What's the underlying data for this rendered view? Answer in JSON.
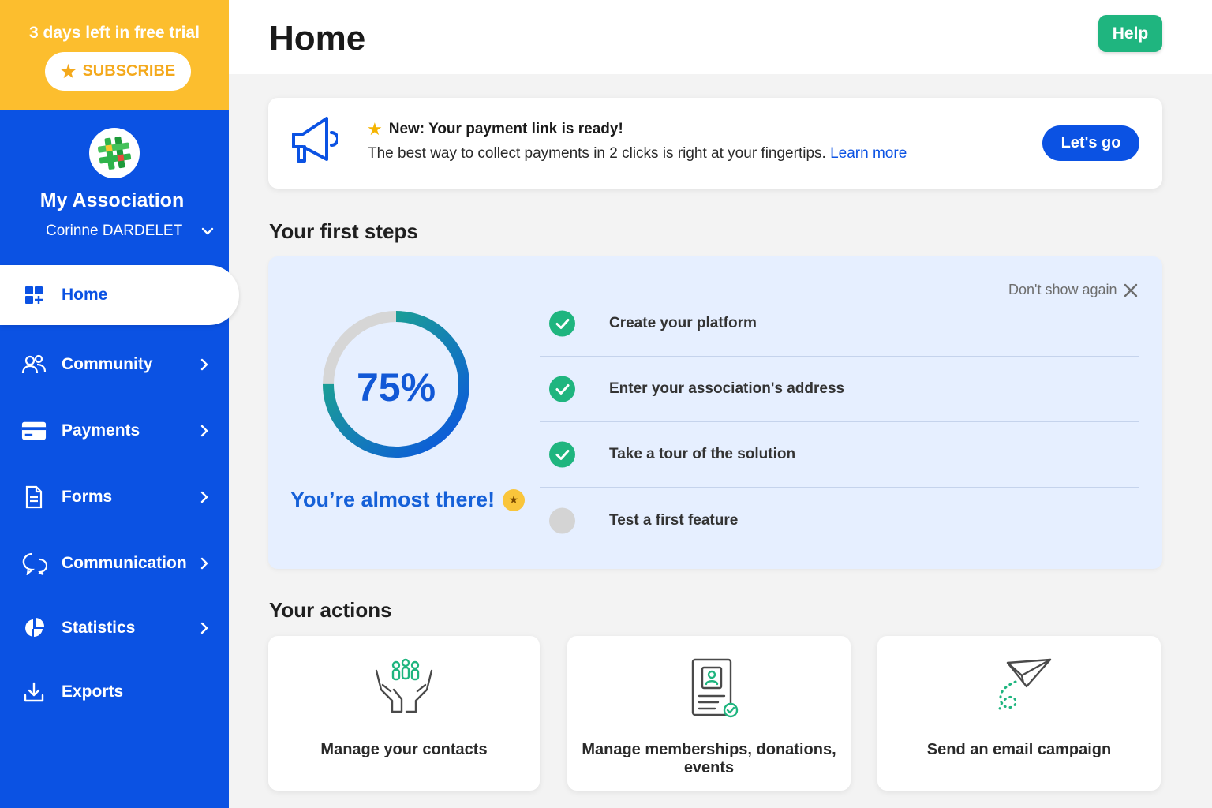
{
  "trial": {
    "text": "3 days left in free trial",
    "subscribe_label": "SUBSCRIBE"
  },
  "organization": {
    "name": "My Association",
    "user": "Corinne DARDELET"
  },
  "nav": {
    "items": [
      {
        "label": "Home",
        "icon": "home-grid-icon",
        "active": true
      },
      {
        "label": "Community",
        "icon": "users-icon"
      },
      {
        "label": "Payments",
        "icon": "card-icon"
      },
      {
        "label": "Forms",
        "icon": "document-icon"
      },
      {
        "label": "Communication",
        "icon": "chat-icon"
      },
      {
        "label": "Statistics",
        "icon": "pie-chart-icon"
      },
      {
        "label": "Exports",
        "icon": "download-icon"
      }
    ]
  },
  "header": {
    "title": "Home",
    "help_label": "Help"
  },
  "banner": {
    "title": "New: Your payment link is ready!",
    "text": "The best way to collect payments in 2 clicks is right at your fingertips.",
    "link": "Learn more",
    "cta_label": "Let's go"
  },
  "first_steps": {
    "title": "Your first steps",
    "progress": 75,
    "progress_label": "75%",
    "almost_text": "You’re almost there!",
    "dont_show_label": "Don't show again",
    "steps": [
      {
        "label": "Create your platform",
        "done": true
      },
      {
        "label": "Enter your association's address",
        "done": true
      },
      {
        "label": "Take a tour of the solution",
        "done": true
      },
      {
        "label": "Test a first feature",
        "done": false
      }
    ]
  },
  "actions": {
    "title": "Your actions",
    "items": [
      {
        "label": "Manage your contacts",
        "icon": "hands-people-icon"
      },
      {
        "label": "Manage memberships, donations, events",
        "icon": "membership-card-icon"
      },
      {
        "label": "Send an email campaign",
        "icon": "paper-plane-icon"
      }
    ]
  },
  "colors": {
    "sidebar": "#0b52e3",
    "trial": "#fcbe2e",
    "help": "#1fb57f",
    "accent": "#0b52e3",
    "check": "#1fb57f",
    "steps_bg": "#e6efff"
  }
}
